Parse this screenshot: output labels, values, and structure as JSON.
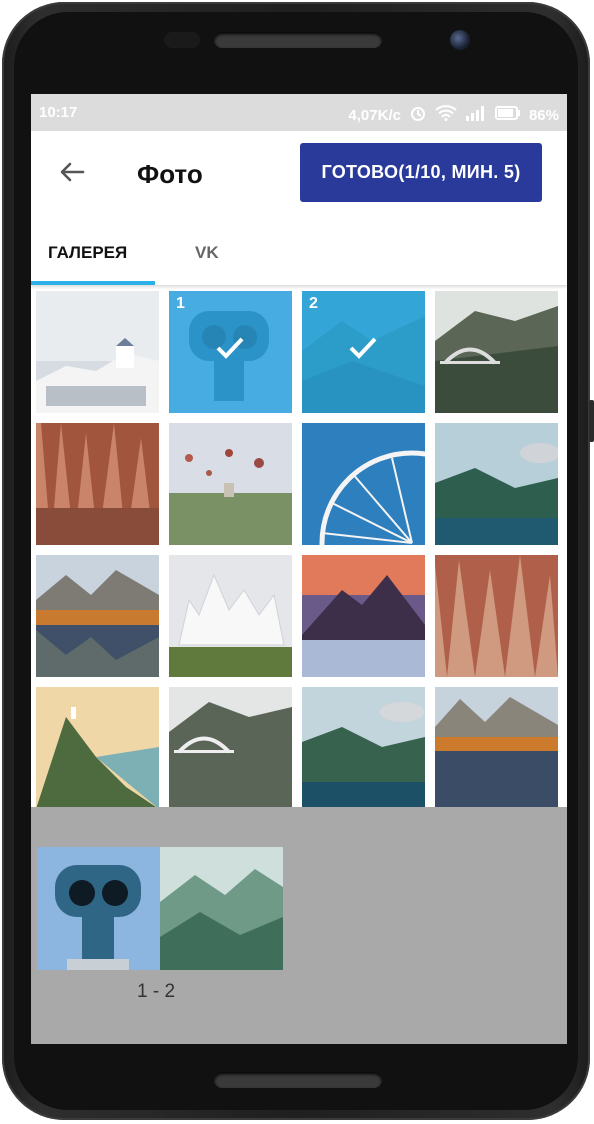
{
  "status_bar": {
    "time": "10:17",
    "network_speed": "4,07K/c",
    "battery": "86%"
  },
  "app_bar": {
    "title": "Фото",
    "done_button": "ГОТОВО(1/10, МИН. 5)"
  },
  "tabs": [
    {
      "label": "ГАЛЕРЕЯ",
      "active": true
    },
    {
      "label": "VK",
      "active": false
    }
  ],
  "selection": {
    "first": "1",
    "second": "2",
    "range_label": "1 - 2"
  },
  "colors": {
    "accent": "#2a3a9a",
    "tab_indicator": "#2cb0e8",
    "selected_overlay": "#2ba8e6",
    "tray": "#a9a9a9"
  }
}
